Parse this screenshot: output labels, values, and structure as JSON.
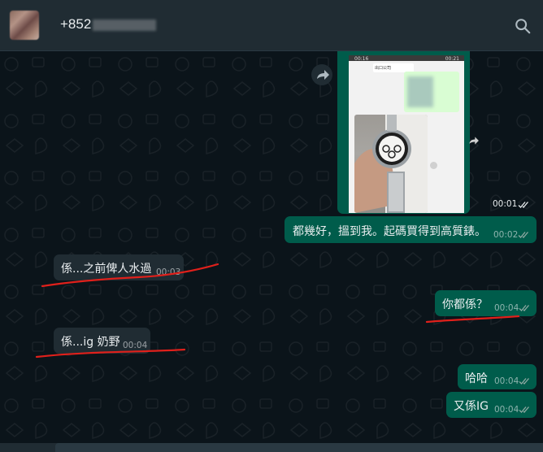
{
  "header": {
    "contact_name": "+852",
    "avatar_icon": "contact-avatar",
    "search_icon": "search-icon"
  },
  "media_message": {
    "time": "00:01",
    "screenshot": {
      "status_left": "00:16",
      "status_right": "00:21",
      "inner_text": "出口公司"
    },
    "status": "read"
  },
  "messages": [
    {
      "id": "m1",
      "direction": "outgoing",
      "text": "都幾好，搵到我。起碼買得到高質錶。",
      "time": "00:02",
      "status": "read"
    },
    {
      "id": "m2",
      "direction": "incoming",
      "text": "係...之前俾人水過",
      "time": "00:03"
    },
    {
      "id": "m3",
      "direction": "outgoing",
      "text": "你都係？",
      "time": "00:04",
      "status": "read"
    },
    {
      "id": "m4",
      "direction": "incoming",
      "text": "係...ig 奶野",
      "time": "00:04"
    },
    {
      "id": "m5",
      "direction": "outgoing",
      "text": "哈哈",
      "time": "00:04",
      "status": "read"
    },
    {
      "id": "m6",
      "direction": "outgoing",
      "text": "又係IG",
      "time": "00:04",
      "status": "read"
    }
  ],
  "colors": {
    "background": "#0b141a",
    "header": "#202c33",
    "incoming_bubble": "#202c33",
    "outgoing_bubble": "#005c4b",
    "annotation_underline": "#e0201b"
  }
}
